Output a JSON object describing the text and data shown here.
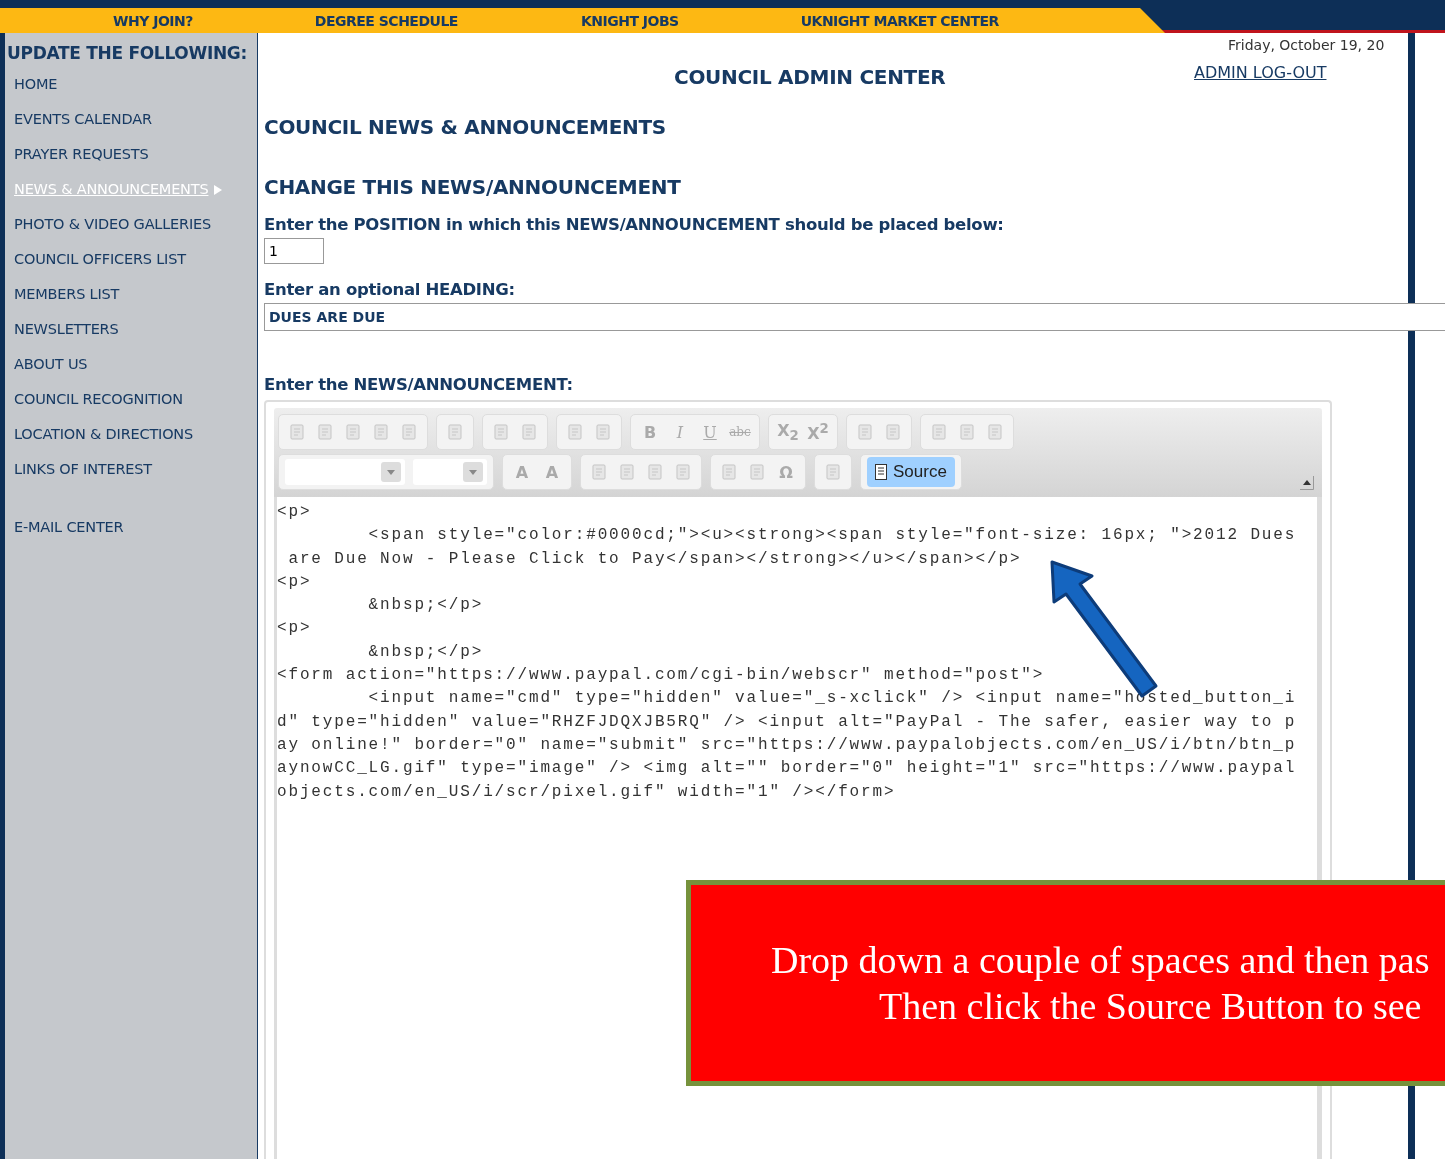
{
  "top_nav": [
    {
      "label": "WHY JOIN?"
    },
    {
      "label": "DEGREE SCHEDULE"
    },
    {
      "label": "KNIGHT JOBS"
    },
    {
      "label": "UKNIGHT MARKET CENTER"
    }
  ],
  "sidebar": {
    "title": "UPDATE THE FOLLOWING:",
    "items": [
      {
        "label": "HOME",
        "selected": false
      },
      {
        "label": "EVENTS CALENDAR",
        "selected": false
      },
      {
        "label": "PRAYER REQUESTS",
        "selected": false
      },
      {
        "label": "NEWS & ANNOUNCEMENTS",
        "selected": true
      },
      {
        "label": "PHOTO & VIDEO GALLERIES",
        "selected": false
      },
      {
        "label": "COUNCIL OFFICERS LIST",
        "selected": false
      },
      {
        "label": "MEMBERS LIST",
        "selected": false
      },
      {
        "label": "NEWSLETTERS",
        "selected": false
      },
      {
        "label": "ABOUT US",
        "selected": false
      },
      {
        "label": "COUNCIL RECOGNITION",
        "selected": false
      },
      {
        "label": "LOCATION & DIRECTIONS",
        "selected": false
      },
      {
        "label": "LINKS OF INTEREST",
        "selected": false
      }
    ],
    "extra_items": [
      {
        "label": "E-MAIL CENTER",
        "selected": false
      }
    ]
  },
  "header": {
    "date": "Friday, October 19, 20",
    "title": "COUNCIL ADMIN CENTER",
    "logout": "ADMIN LOG-OUT"
  },
  "section_title": "COUNCIL NEWS & ANNOUNCEMENTS",
  "form_title": "CHANGE THIS NEWS/ANNOUNCEMENT",
  "position": {
    "label": "Enter the POSITION in which this NEWS/ANNOUNCEMENT should be placed below:",
    "value": "1"
  },
  "heading": {
    "label": "Enter an optional HEADING:",
    "value": "DUES ARE DUE"
  },
  "body_label": "Enter the NEWS/ANNOUNCEMENT:",
  "toolbar": {
    "top_row": [
      [
        {
          "kind": "icon"
        },
        {
          "kind": "icon"
        },
        {
          "kind": "icon"
        },
        {
          "kind": "icon"
        },
        {
          "kind": "icon"
        }
      ],
      [
        {
          "kind": "icon"
        }
      ],
      [
        {
          "kind": "icon"
        },
        {
          "kind": "icon"
        }
      ],
      [
        {
          "kind": "icon"
        },
        {
          "kind": "icon"
        }
      ],
      [
        {
          "kind": "bold",
          "label": "B"
        },
        {
          "kind": "italic",
          "label": "I"
        },
        {
          "kind": "underline",
          "label": "U"
        },
        {
          "kind": "strike",
          "label": "abc"
        }
      ],
      [
        {
          "kind": "bold",
          "label": "X$_{2}$"
        },
        {
          "kind": "bold",
          "label": "X$^{2}$"
        }
      ],
      [
        {
          "kind": "icon"
        },
        {
          "kind": "icon"
        }
      ],
      [
        {
          "kind": "icon"
        },
        {
          "kind": "icon"
        },
        {
          "kind": "icon"
        }
      ]
    ],
    "bottom_row": [
      [
        {
          "kind": "combo"
        },
        {
          "kind": "combo"
        }
      ],
      [
        {
          "kind": "bold",
          "label": "A"
        },
        {
          "kind": "bold",
          "label": "A"
        }
      ],
      [
        {
          "kind": "icon"
        },
        {
          "kind": "icon"
        },
        {
          "kind": "icon"
        },
        {
          "kind": "icon"
        }
      ],
      [
        {
          "kind": "icon"
        },
        {
          "kind": "icon"
        },
        {
          "kind": "bold",
          "label": "Ω"
        }
      ],
      [
        {
          "kind": "icon"
        }
      ],
      [
        {
          "kind": "button",
          "label": "Source",
          "selected": true
        }
      ]
    ]
  },
  "source_lines": [
    "<p>",
    "        <span style=\"color:#0000cd;\"><u><strong><span style=\"font-size: 16px; \">2012 Dues",
    " are Due Now - Please Click to Pay</span></strong></u></span></p>",
    "<p>",
    "        &nbsp;</p>",
    "<p>",
    "        &nbsp;</p>",
    "<form action=\"https://www.paypal.com/cgi-bin/webscr\" method=\"post\">",
    "        <input name=\"cmd\" type=\"hidden\" value=\"_s-xclick\" /> <input name=\"hosted_button_i",
    "d\" type=\"hidden\" value=\"RHZFJDQXJB5RQ\" /> <input alt=\"PayPal - The safer, easier way to p",
    "ay online!\" border=\"0\" name=\"submit\" src=\"https://www.paypalobjects.com/en_US/i/btn/btn_p",
    "aynowCC_LG.gif\" type=\"image\" /> <img alt=\"\" border=\"0\" height=\"1\" src=\"https://www.paypal",
    "objects.com/en_US/i/scr/pixel.gif\" width=\"1\" /></form>"
  ],
  "callout": {
    "lines": [
      "Drop down a couple of spaces and then pas",
      "Then click the Source Button to see"
    ]
  }
}
